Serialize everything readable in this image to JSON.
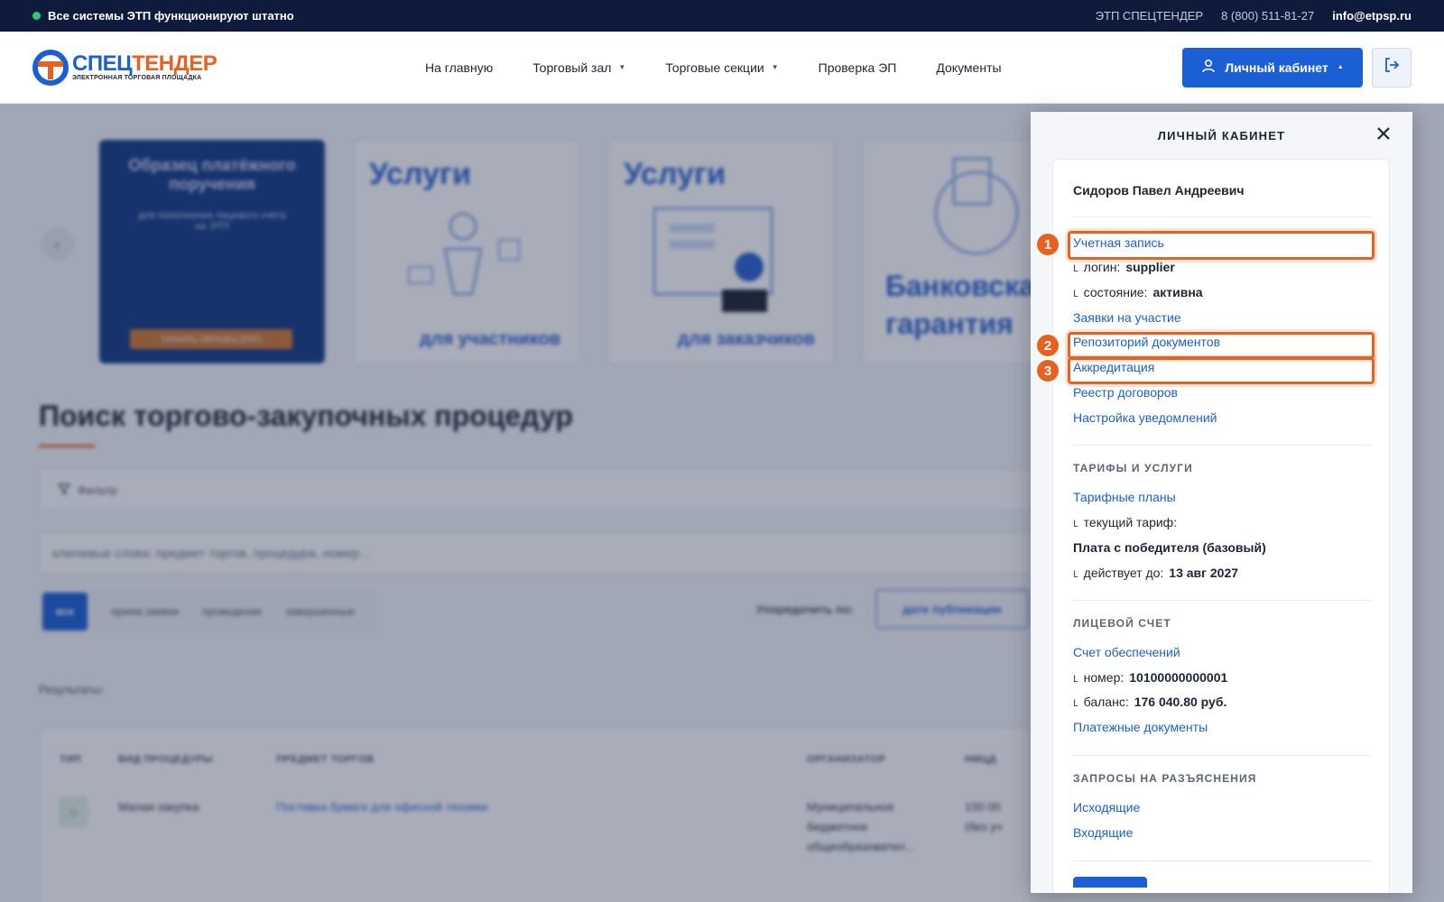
{
  "topbar": {
    "status": "Все системы ЭТП функционируют штатно",
    "platform": "ЭТП СПЕЦТЕНДЕР",
    "phone": "8 (800) 511-81-27",
    "email": "info@etpsp.ru"
  },
  "header": {
    "logo_brand_1": "СПЕЦ",
    "logo_brand_2": "ТЕНДЕР",
    "logo_sub": "ЭЛЕКТРОННАЯ ТОРГОВАЯ ПЛОЩАДКА",
    "nav": [
      "На главную",
      "Торговый зал",
      "Торговые секции",
      "Проверка ЭП",
      "Документы"
    ],
    "cabinet_label": "Личный кабинет"
  },
  "background": {
    "banners": [
      {
        "title": "Образец платёжного поручения",
        "subtitle": "для пополнения лицевого счёта на ЭТП",
        "button": "СКАЧАТЬ ОБРАЗЕЦ (PDF)"
      },
      {
        "title": "Услуги",
        "subtitle": "для участников"
      },
      {
        "title": "Услуги",
        "subtitle": "для заказчиков"
      },
      {
        "title": "Банковская гарантия"
      }
    ],
    "page_title": "Поиск торгово-закупочных процедур",
    "filter_label": "Фильтр",
    "search_placeholder": "ключевые слова: предмет торгов, процедура, номер...",
    "status_tabs": [
      "все",
      "прием заявки",
      "проведение",
      "завершенные"
    ],
    "sort_label": "Упорядочить по:",
    "sort_value": "дате публикации",
    "results_label": "Результаты:",
    "table": {
      "headers": [
        "ТИП",
        "ВИД ПРОЦЕДУРЫ",
        "ПРЕДМЕТ ТОРГОВ",
        "ОРГАНИЗАТОР",
        "НМЦД"
      ],
      "rows": [
        {
          "type_icon": "building-icon",
          "kind": "Малая закупка",
          "subject": "Поставка бумаги для офисной техники",
          "organizer": "Муниципальное бюджетное общеобразовател...",
          "price": "150 00",
          "price_note": "(без уч"
        }
      ]
    }
  },
  "panel": {
    "title": "ЛИЧНЫЙ КАБИНЕТ",
    "user_name": "Сидоров Павел Андреевич",
    "account": {
      "link": "Учетная запись",
      "login_label": "логин:",
      "login_value": "supplier",
      "state_label": "состояние:",
      "state_value": "активна"
    },
    "links": [
      "Заявки на участие",
      "Репозиторий документов",
      "Аккредитация",
      "Реестр договоров",
      "Настройка уведомлений"
    ],
    "tariffs": {
      "title": "ТАРИФЫ И УСЛУГИ",
      "link": "Тарифные планы",
      "current_label": "текущий тариф:",
      "current_value": "Плата с победителя (базовый)",
      "valid_label": "действует до:",
      "valid_value": "13 авг 2027"
    },
    "account_balance": {
      "title": "ЛИЦЕВОЙ СЧЕТ",
      "link": "Счет обеспечений",
      "number_label": "номер:",
      "number_value": "10100000000001",
      "balance_label": "баланс:",
      "balance_value": "176 040.80 руб.",
      "docs_link": "Платежные документы"
    },
    "requests": {
      "title": "ЗАПРОСЫ НА РАЗЪЯСНЕНИЯ",
      "outgoing": "Исходящие",
      "incoming": "Входящие"
    }
  },
  "annotations": [
    "1",
    "2",
    "3"
  ],
  "colors": {
    "accent_blue": "#1a5fd6",
    "accent_orange": "#e8621f",
    "topbar_bg": "#0f1b3d",
    "status_green": "#2ecc71"
  }
}
